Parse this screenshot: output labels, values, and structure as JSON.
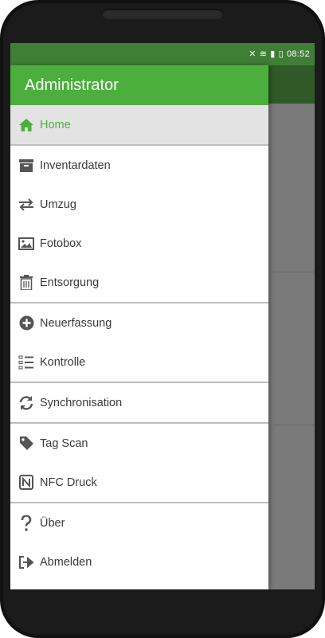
{
  "status_bar": {
    "time": "08:52"
  },
  "drawer": {
    "title": "Administrator",
    "items": [
      {
        "label": "Home",
        "icon": "home-icon",
        "active": true
      },
      {
        "label": "Inventardaten",
        "icon": "archive-icon"
      },
      {
        "label": "Umzug",
        "icon": "exchange-arrows-icon"
      },
      {
        "label": "Fotobox",
        "icon": "image-icon"
      },
      {
        "label": "Entsorgung",
        "icon": "trash-icon"
      },
      {
        "label": "Neuerfassung",
        "icon": "plus-circle-icon"
      },
      {
        "label": "Kontrolle",
        "icon": "checklist-icon"
      },
      {
        "label": "Synchronisation",
        "icon": "sync-icon"
      },
      {
        "label": "Tag Scan",
        "icon": "tag-icon"
      },
      {
        "label": "NFC Druck",
        "icon": "nfc-icon"
      },
      {
        "label": "Über",
        "icon": "question-icon"
      },
      {
        "label": "Abmelden",
        "icon": "sign-out-icon"
      }
    ]
  },
  "colors": {
    "accent": "#4caf3d",
    "status_bar": "#3f7f35",
    "text": "#3a3a3a",
    "active_bg": "#e3e3e3"
  }
}
